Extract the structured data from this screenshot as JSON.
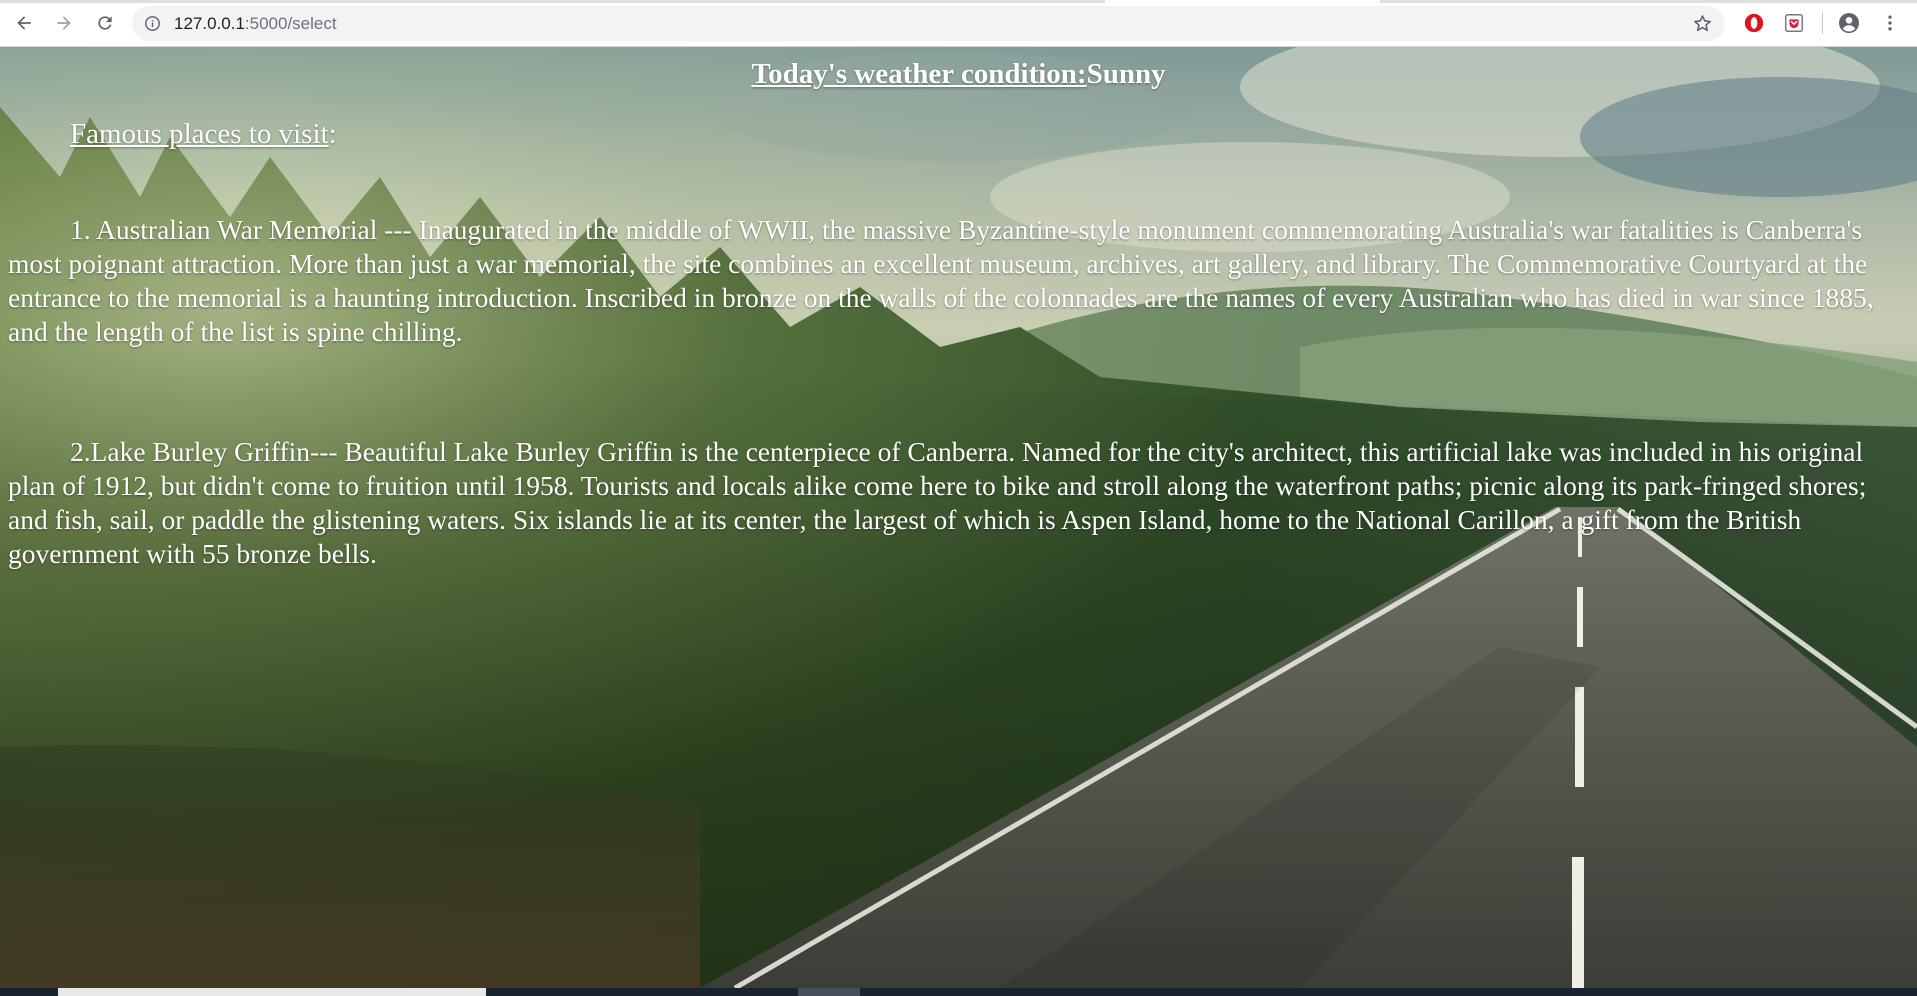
{
  "browser": {
    "url_host": "127.0.0.1",
    "url_path": ":5000/select",
    "icons": [
      "back-arrow-icon",
      "forward-arrow-icon",
      "reload-icon",
      "info-icon",
      "star-icon",
      "opera-extension-icon",
      "pocket-extension-icon",
      "account-icon",
      "more-vert-icon"
    ]
  },
  "page": {
    "weather_label": "Today's weather condition:",
    "weather_value": "Sunny",
    "places_heading": "Famous places to visit",
    "places_heading_colon": ":",
    "places": [
      {
        "text": "1. Australian War Memorial --- Inaugurated in the middle of WWII, the massive Byzantine-style monument commemorating Australia's war fatalities is Canberra's most poignant attraction. More than just a war memorial, the site combines an excellent museum, archives, art gallery, and library. The Commemorative Courtyard at the entrance to the memorial is a haunting introduction. Inscribed in bronze on the walls of the colonnades are the names of every Australian who has died in war since 1885, and the length of the list is spine chilling."
      },
      {
        "text": "2.Lake Burley Griffin--- Beautiful Lake Burley Griffin is the centerpiece of Canberra. Named for the city's architect, this artificial lake was included in his original plan of 1912, but didn't come to fruition until 1958. Tourists and locals alike come here to bike and stroll along the waterfront paths; picnic along its park-fringed shores; and fish, sail, or paddle the glistening waters. Six islands lie at its center, the largest of which is Aspen Island, home to the National Carillon, a gift from the British government with 55 bronze bells."
      }
    ]
  },
  "colors": {
    "text": "#ffffff",
    "chrome_bg": "#ffffff",
    "omnibox_bg": "#f1f3f4"
  }
}
